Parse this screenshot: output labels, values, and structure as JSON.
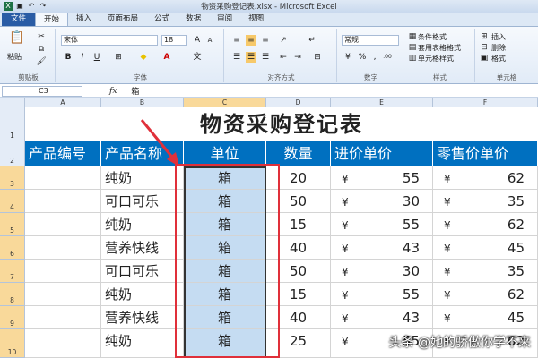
{
  "window": {
    "title": "物资采购登记表.xlsx - Microsoft Excel"
  },
  "tabs": [
    {
      "label": "文件"
    },
    {
      "label": "开始"
    },
    {
      "label": "插入"
    },
    {
      "label": "页面布局"
    },
    {
      "label": "公式"
    },
    {
      "label": "数据"
    },
    {
      "label": "审阅"
    },
    {
      "label": "视图"
    }
  ],
  "ribbon": {
    "clipboard": {
      "paste": "粘贴",
      "label": "剪贴板"
    },
    "font": {
      "name": "宋体",
      "size": "18",
      "label": "字体",
      "bold": "B",
      "italic": "I",
      "underline": "U"
    },
    "alignment": {
      "label": "对齐方式"
    },
    "number": {
      "format": "常规",
      "label": "数字",
      "percent": "%",
      "comma": ","
    },
    "styles": {
      "conditional": "条件格式",
      "table": "套用表格格式",
      "cell": "单元格样式",
      "label": "样式"
    },
    "cells": {
      "insert": "插入",
      "delete": "删除",
      "format": "格式",
      "label": "单元格"
    }
  },
  "formula_bar": {
    "name_box": "C3",
    "fx": "fx",
    "value": "箱"
  },
  "columns": [
    "A",
    "B",
    "C",
    "D",
    "E",
    "F"
  ],
  "rows": [
    "1",
    "2",
    "3",
    "4",
    "5",
    "6",
    "7",
    "8",
    "9",
    "10"
  ],
  "sheet": {
    "title": "物资采购登记表",
    "headers": [
      "产品编号",
      "产品名称",
      "单位",
      "数量",
      "进价单价",
      "零售价单价"
    ],
    "currency": "¥",
    "data": [
      {
        "name": "纯奶",
        "unit": "箱",
        "qty": "20",
        "cost": "55",
        "retail": "62"
      },
      {
        "name": "可口可乐",
        "unit": "箱",
        "qty": "50",
        "cost": "30",
        "retail": "35"
      },
      {
        "name": "纯奶",
        "unit": "箱",
        "qty": "15",
        "cost": "55",
        "retail": "62"
      },
      {
        "name": "营养快线",
        "unit": "箱",
        "qty": "40",
        "cost": "43",
        "retail": "45"
      },
      {
        "name": "可口可乐",
        "unit": "箱",
        "qty": "50",
        "cost": "30",
        "retail": "35"
      },
      {
        "name": "纯奶",
        "unit": "箱",
        "qty": "15",
        "cost": "55",
        "retail": "62"
      },
      {
        "name": "营养快线",
        "unit": "箱",
        "qty": "40",
        "cost": "43",
        "retail": "45"
      },
      {
        "name": "纯奶",
        "unit": "箱",
        "qty": "25",
        "cost": "55",
        "retail": "62"
      }
    ]
  },
  "watermark": "头条 @她的骄傲你学不来",
  "colors": {
    "header_bg": "#0070c0",
    "selected_cell_bg": "#c5dcf2",
    "annotation_red": "#e0303a"
  }
}
